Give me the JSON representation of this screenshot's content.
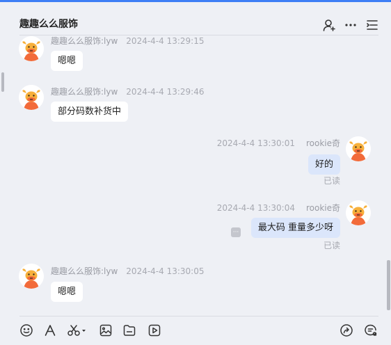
{
  "header": {
    "title": "趣趣么么服饰",
    "icons": [
      "add-member-icon",
      "more-icon",
      "list-icon"
    ]
  },
  "messages": [
    {
      "direction": "in",
      "sender": "趣趣么么服饰:lyw",
      "time": "2024-4-4 13:29:15",
      "text": "嗯嗯"
    },
    {
      "direction": "in",
      "sender": "趣趣么么服饰:lyw",
      "time": "2024-4-4 13:29:46",
      "text": "部分码数补货中"
    },
    {
      "direction": "out",
      "sender": "rookie奇",
      "time": "2024-4-4 13:30:01",
      "text": "好的",
      "status": "已读"
    },
    {
      "direction": "out",
      "sender": "rookie奇",
      "time": "2024-4-4 13:30:04",
      "text": "最大码  重量多少呀",
      "status": "已读"
    },
    {
      "direction": "in",
      "sender": "趣趣么么服饰:lyw",
      "time": "2024-4-4 13:30:05",
      "text": "嗯嗯"
    }
  ],
  "toolbar": {
    "icons": [
      "emoji-icon",
      "font-icon",
      "scissors-icon",
      "image-icon",
      "folder-icon",
      "video-icon",
      "share-icon",
      "chat-settings-icon"
    ]
  },
  "colors": {
    "accent": "#3d7ef5",
    "background": "#eef0f5",
    "outgoing_bubble": "#dbe6fb",
    "incoming_bubble": "#ffffff"
  }
}
